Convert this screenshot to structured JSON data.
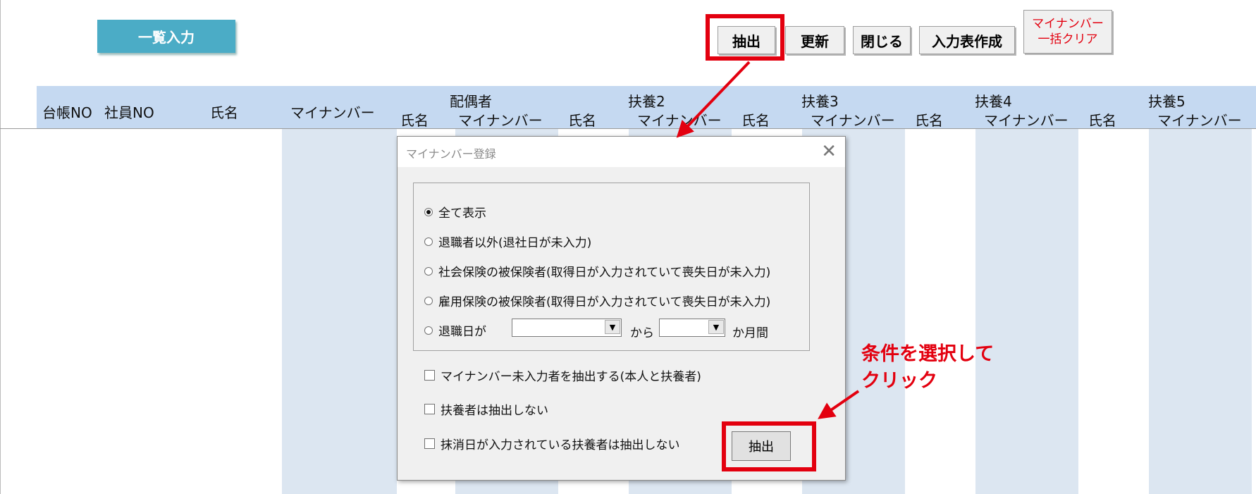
{
  "toolbar": {
    "ichiran": "一覧入力",
    "extract": "抽出",
    "update": "更新",
    "close": "閉じる",
    "input_form": "入力表作成",
    "clear_line1": "マイナンバー",
    "clear_line2": "一括クリア"
  },
  "table": {
    "cols": {
      "ledger_no": "台帳NO",
      "employee_no": "社員NO",
      "name": "氏名",
      "mynumber": "マイナンバー"
    },
    "groups": [
      "配偶者",
      "扶養2",
      "扶養3",
      "扶養4",
      "扶養5"
    ],
    "sub_name": "氏名",
    "sub_mynumber": "マイナンバー"
  },
  "dialog": {
    "title": "マイナンバー登録",
    "options": [
      "全て表示",
      "退職者以外(退社日が未入力)",
      "社会保険の被保険者(取得日が入力されていて喪失日が未入力)",
      "雇用保険の被保険者(取得日が入力されていて喪失日が未入力)",
      "退職日が"
    ],
    "selected_option": 0,
    "from_label": "から",
    "months_label": "か月間",
    "checks": [
      "マイナンバー未入力者を抽出する(本人と扶養者)",
      "扶養者は抽出しない",
      "抹消日が入力されている扶養者は抽出しない"
    ],
    "extract_button": "抽出"
  },
  "annotation": {
    "line1": "条件を選択して",
    "line2": "クリック"
  },
  "colors": {
    "accent_red": "#e3000f",
    "header_blue": "#c5d9f1",
    "stripe_blue": "#dce6f1",
    "ichiran_teal": "#4bacc6"
  }
}
